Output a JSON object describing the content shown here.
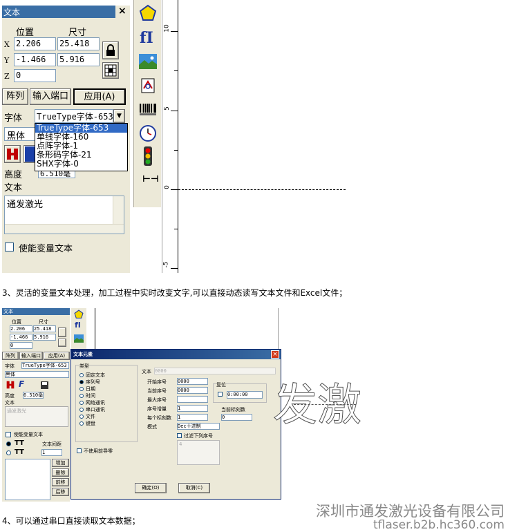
{
  "screen1": {
    "title": "文本",
    "close": "×",
    "pos_header": "位置",
    "size_header": "尺寸",
    "x_label": "X",
    "y_label": "Y",
    "z_label": "Z",
    "x_pos": "2.206",
    "x_size": "25.418",
    "y_pos": "-1.466",
    "y_size": "5.916",
    "z_pos": "0",
    "tab_array": "阵列",
    "tab_input": "输入端口",
    "apply_btn": "应用(A)",
    "font_label": "字体",
    "font_selected": "TrueType字体-653",
    "font_name": "黑体",
    "font_options": [
      "TrueType字体-653",
      "单线字体-160",
      "点阵字体-1",
      "条形码字体-21",
      "SHX字体-0"
    ],
    "height_label": "高度",
    "height_value": "6.510毫",
    "text_label": "文本",
    "text_value": "通发激光",
    "enable_var": "使能变量文本",
    "ruler_labels": [
      "10",
      "5",
      "0",
      "-5"
    ]
  },
  "caption3": "3、灵活的变量文本处理，加工过程中实时改变文字,可以直接动态读写文本文件和Excel文件；",
  "screen2": {
    "title": "文本",
    "pos_header": "位置",
    "size_header": "尺寸",
    "x_pos": "2.206",
    "x_size": "25.418",
    "y_pos": "-1.466",
    "y_size": "5.916",
    "z_pos": "0",
    "tab_array": "阵列",
    "tab_input": "输入端口",
    "apply_btn": "应用(A)",
    "font_label": "字体",
    "font_selected": "TrueType字体-653",
    "font_name": "黑体",
    "height_label": "高度",
    "height_value": "6.510毫",
    "text_label": "文本",
    "text_value": "通发激光",
    "enable_var": "使能变量文本",
    "text_spacing": "文本间距",
    "spacing_value": "1",
    "btn_add": "增加",
    "btn_delete": "删除",
    "btn_prev": "前移",
    "btn_next": "后移",
    "canvas_text": "发激"
  },
  "dialog": {
    "title": "文本元素",
    "type_group": "类型",
    "types": [
      "固定文本",
      "序列号",
      "日期",
      "时间",
      "网络通讯",
      "串口通讯",
      "文件",
      "键盘"
    ],
    "no_leading_zero": "不使用前导零",
    "text_label": "文本",
    "text_value": "0000",
    "start_label": "开始序号",
    "start_value": "0000",
    "current_label": "当前序号",
    "current_value": "0000",
    "max_label": "最大序号",
    "max_value": "",
    "increment_label": "序号增量",
    "increment_value": "1",
    "per_mark_label": "每个标刻数",
    "per_mark_value": "1",
    "mode_label": "模式",
    "mode_value": "Dec十进制",
    "current_count_label": "当前标刻数",
    "current_count_value": "0",
    "reset_group": "复位",
    "reset_time": "0:00:00",
    "filter_label": "过滤下列序号",
    "filter_value": "4",
    "ok_btn": "确定(O)",
    "cancel_btn": "取消(C)"
  },
  "watermark_line1": "深圳市通发激光设备有限公司",
  "watermark_line2": "tflaser.b2b.hc360.com",
  "caption4": "4、可以通过串口直接读取文本数据；"
}
